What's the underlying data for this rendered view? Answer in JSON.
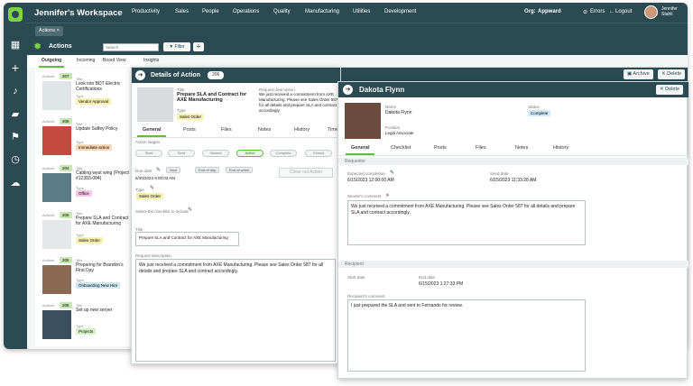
{
  "app": {
    "workspace_title": "Jennifer's Workspace",
    "nav": [
      "Productivity",
      "Sales",
      "People",
      "Operations",
      "Quality",
      "Manufacturing",
      "Utilities",
      "Development"
    ],
    "org_label": "Org:",
    "org_name": "Appward",
    "errors": "Errors",
    "logout": "Logout",
    "user_name": "Jennifer Stahli",
    "subbar_chip": "Actions ×",
    "actions_title": "Actions",
    "search_placeholder": "Search",
    "filter_label": "Filter",
    "add_label": "+",
    "list_tabs": [
      "Outgoing",
      "Incoming",
      "Board View",
      "Insights"
    ]
  },
  "list": [
    {
      "id": "Action#",
      "num": "207",
      "title_label": "Title",
      "title": "Look into BDT Electric Certifications",
      "type_label": "Type",
      "type": "Vendor Approval",
      "type_color": "#f7f1b0"
    },
    {
      "id": "Action#",
      "num": "206",
      "title_label": "Title",
      "title": "Update Saftey Policy",
      "type_label": "Type",
      "type": "Immediate action",
      "type_color": "#f9d8b8"
    },
    {
      "id": "Action#",
      "num": "204",
      "title_label": "Title",
      "title": "Cabling west wing (Project #12303-004)",
      "type_label": "Type",
      "type": "Office",
      "type_color": "#f6c6e6"
    },
    {
      "id": "Action#",
      "num": "206",
      "title_label": "Title",
      "title": "Prepare SLA and Contract for AXE Manufacturing",
      "type_label": "Type",
      "type": "Sales Order",
      "type_color": "#f7f1b0"
    },
    {
      "id": "Action#",
      "num": "205",
      "title_label": "Title",
      "title": "Preparing for Brandon's First Day",
      "type_label": "Type",
      "type": "Onboarding New Hire",
      "type_color": "#cde8f8"
    },
    {
      "id": "Action#",
      "num": "205",
      "title_label": "Title",
      "title": "Set up new server",
      "type_label": "Type",
      "type": "Projects",
      "type_color": "#d6f0c8"
    }
  ],
  "details": {
    "header": "Details of Action",
    "number": "206",
    "title_label": "Title",
    "title": "Prepare SLA and Contract for AXE Manufacturing",
    "type_label": "Type",
    "type": "Sales Order",
    "request_label": "Request description",
    "request_desc": "We just received a commitment from AXE Manufacturing. Please see Sales Order 587 for all details and prepare SLA and contract accordingly.",
    "tabs": [
      "General",
      "Posts",
      "Files",
      "Notes",
      "History",
      "Timel"
    ],
    "stages_label": "Action stages",
    "stages": [
      "Start",
      "Sent",
      "Viewed",
      "Active",
      "Complete",
      "Closed"
    ],
    "due_label": "Due date",
    "due_date": "6/30/2023 9:00:03 AM",
    "due_pills": [
      "Now",
      "End of day",
      "End of week"
    ],
    "close_btn": "Close out Action",
    "type2_label": "Type",
    "type2": "Sales Order",
    "checklist_label": "Select the checklist to include",
    "title2_label": "Title",
    "title2": "Prepare SLA and Contract for AXE Manufacturing",
    "request2_label": "Request description",
    "request2": "We just received a commitment from AXE Manufacturing. Please see Sales Order 587 for all details and prepare SLA and contract accordingly."
  },
  "dakota": {
    "name_header": "Dakota Flynn",
    "archive": "Archive",
    "delete": "Delete",
    "delete2": "Delete",
    "name_label": "Name",
    "name": "Dakota Flynn",
    "position_label": "Position",
    "position": "Legal Associate",
    "status_label": "Status",
    "status": "Complete",
    "tabs": [
      "General",
      "Checklist",
      "Posts",
      "Files",
      "Notes",
      "History"
    ],
    "section_requestor": "Requestor",
    "expected_label": "Expected completion",
    "expected": "6/15/2023 12:00:00 AM",
    "send_label": "Send date",
    "send": "6/15/2023 11:33:28 AM",
    "sender_comment_label": "Sender's comment",
    "sender_comment": "We just received a commitment from AXE Manufacturing. Please see Sales Order 587 for all details and prepare SLA and contract accordingly.",
    "section_recipient": "Recipient",
    "start_label": "Start date",
    "end_label": "End date",
    "end": "6/15/2023 1:27:33 PM",
    "recipient_comment_label": "Recipient's comment",
    "recipient_comment": "I just prepared the SLA and sent to Fernando for review."
  }
}
